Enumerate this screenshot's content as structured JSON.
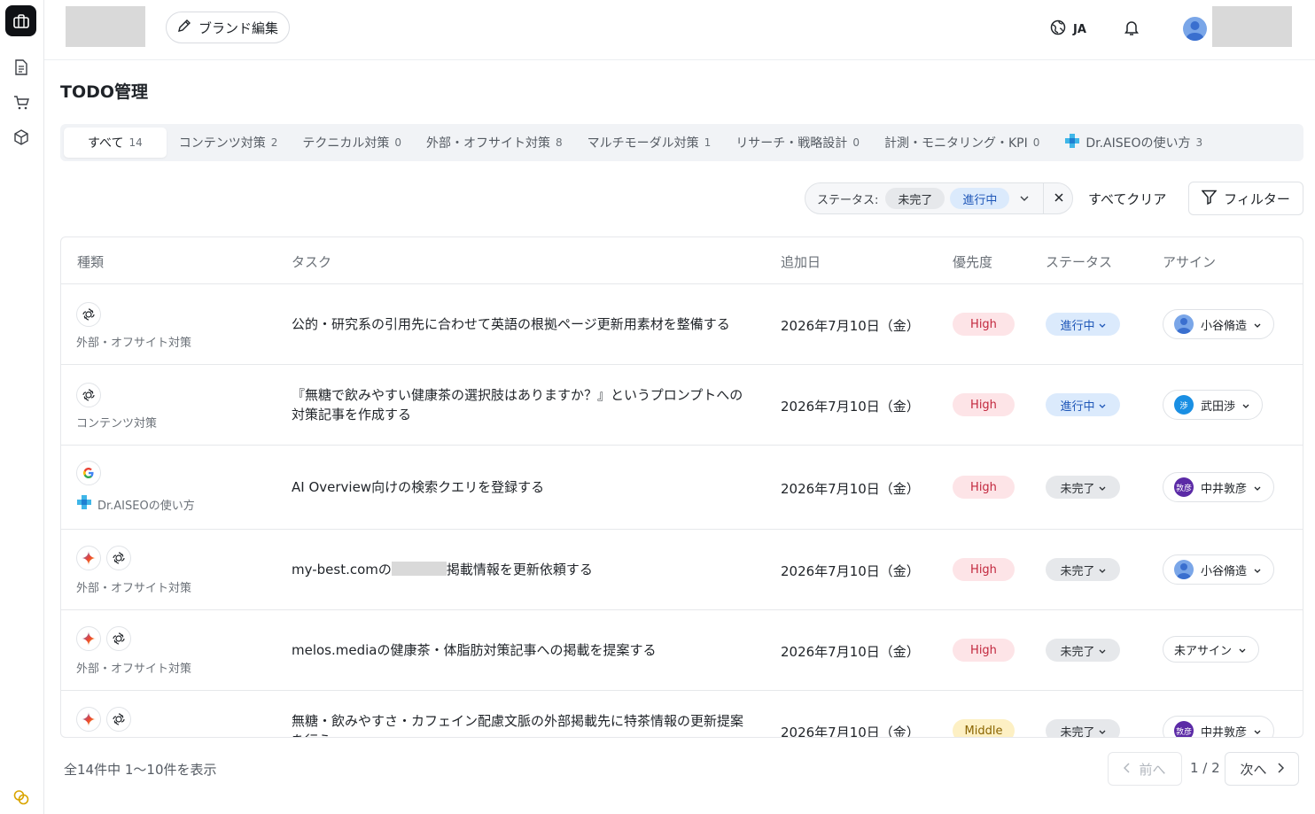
{
  "header": {
    "brand_edit_label": "ブランド編集",
    "language": "JA"
  },
  "page": {
    "title": "TODO管理"
  },
  "tabs": [
    {
      "label": "すべて",
      "count": "14"
    },
    {
      "label": "コンテンツ対策",
      "count": "2"
    },
    {
      "label": "テクニカル対策",
      "count": "0"
    },
    {
      "label": "外部・オフサイト対策",
      "count": "8"
    },
    {
      "label": "マルチモーダル対策",
      "count": "1"
    },
    {
      "label": "リサーチ・戦略設計",
      "count": "0"
    },
    {
      "label": "計測・モニタリング・KPI",
      "count": "0"
    },
    {
      "label": "Dr.AISEOの使い方",
      "count": "3"
    }
  ],
  "filters": {
    "status_label": "ステータス:",
    "chips": [
      "未完了",
      "進行中"
    ],
    "clear_all": "すべてクリア",
    "filter_button": "フィルター"
  },
  "table": {
    "headers": {
      "type": "種類",
      "task": "タスク",
      "date": "追加日",
      "priority": "優先度",
      "status": "ステータス",
      "assign": "アサイン"
    },
    "rows": [
      {
        "type": "外部・オフサイト対策",
        "task": "公的・研究系の引用先に合わせて英語の根拠ページ更新用素材を整備する",
        "date": "2026年7月10日（金）",
        "priority": "High",
        "status": "進行中",
        "assignee": "小谷脩造",
        "avatar_text": ""
      },
      {
        "type": "コンテンツ対策",
        "task": "『無糖で飲みやすい健康茶の選択肢はありますか？』というプロンプトへの対策記事を作成する",
        "date": "2026年7月10日（金）",
        "priority": "High",
        "status": "進行中",
        "assignee": "武田渉",
        "avatar_text": "渉"
      },
      {
        "type": "Dr.AISEOの使い方",
        "task": "AI Overview向けの検索クエリを登録する",
        "date": "2026年7月10日（金）",
        "priority": "High",
        "status": "未完了",
        "assignee": "中井敦彦",
        "avatar_text": "敦彦"
      },
      {
        "type": "外部・オフサイト対策",
        "task_prefix": "my-best.comの",
        "task_suffix": "掲載情報を更新依頼する",
        "date": "2026年7月10日（金）",
        "priority": "High",
        "status": "未完了",
        "assignee": "小谷脩造",
        "avatar_text": ""
      },
      {
        "type": "外部・オフサイト対策",
        "task": "melos.mediaの健康茶・体脂肪対策記事への掲載を提案する",
        "date": "2026年7月10日（金）",
        "priority": "High",
        "status": "未完了",
        "assignee": "未アサイン",
        "avatar_text": ""
      },
      {
        "type": "",
        "task": "無糖・飲みやすさ・カフェイン配慮文脈の外部掲載先に特茶情報の更新提案を行う",
        "date": "2026年7月10日（金）",
        "priority": "Middle",
        "status": "未完了",
        "assignee": "中井敦彦",
        "avatar_text": "敦彦"
      }
    ]
  },
  "footer": {
    "summary": "全14件中 1〜10件を表示",
    "prev": "前へ",
    "page": "1 / 2",
    "next": "次へ"
  },
  "colors": {
    "high_bg": "#fde4e7",
    "high_fg": "#c2283e",
    "middle_bg": "#fdf0c4",
    "in_progress_bg": "#dbeafc",
    "in_progress_fg": "#1f57b8",
    "todo_bg": "#e6e8eb"
  }
}
